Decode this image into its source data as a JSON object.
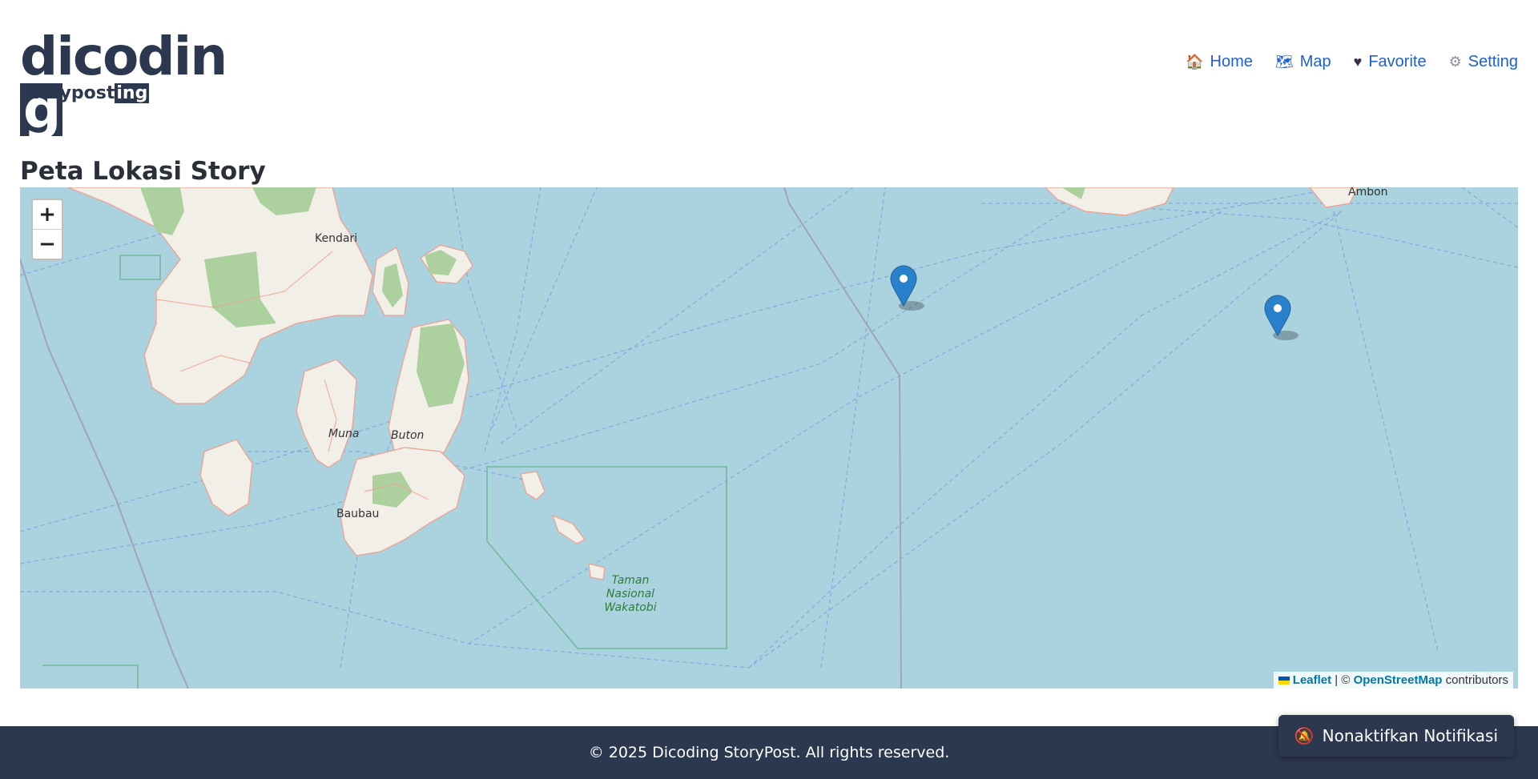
{
  "brand": {
    "word_main": "dicodin",
    "word_last": "g",
    "sub_main": "storypost",
    "sub_last": "ing"
  },
  "nav": [
    {
      "label": "Home",
      "icon": "house-icon",
      "glyph": "🏠"
    },
    {
      "label": "Map",
      "icon": "map-icon",
      "glyph": "🗺"
    },
    {
      "label": "Favorite",
      "icon": "heart-icon",
      "glyph": "♥"
    },
    {
      "label": "Setting",
      "icon": "gear-icon",
      "glyph": "⚙"
    }
  ],
  "page_title": "Peta Lokasi Story",
  "map": {
    "zoom_in": "+",
    "zoom_out": "−",
    "places": {
      "kendari": "Kendari",
      "ambon": "Ambon",
      "muna": "Muna",
      "buton": "Buton",
      "baubau": "Baubau",
      "park1": "Taman",
      "park2": "Nasional",
      "park3": "Wakatobi"
    },
    "attribution": {
      "leaflet": "Leaflet",
      "sep": " | © ",
      "osm": "OpenStreetMap",
      "rest": " contributors"
    }
  },
  "footer": {
    "text": "© 2025 Dicoding StoryPost. All rights reserved."
  },
  "notif_button": {
    "label": "Nonaktifkan Notifikasi",
    "icon": "bell-off-icon",
    "glyph": "🔕"
  },
  "colors": {
    "primary_dark": "#2c3750",
    "link": "#1f5fd6",
    "sea": "#aad3df",
    "land": "#f2efe9",
    "forest": "#add19e",
    "marker": "#2a81cb"
  }
}
